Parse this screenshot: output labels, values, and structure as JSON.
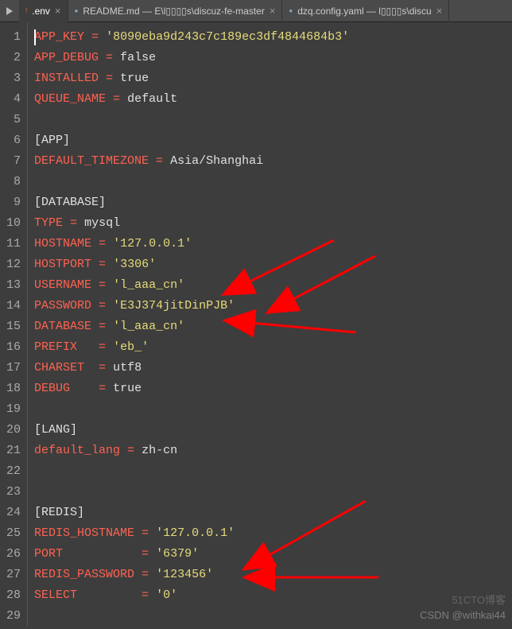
{
  "tabs": [
    {
      "label": ".env",
      "active": true
    },
    {
      "label": "README.md — E\\l▯▯▯▯s\\discuz-fe-master",
      "active": false
    },
    {
      "label": "dzq.config.yaml — l▯▯▯▯s\\discu",
      "active": false
    }
  ],
  "lines": [
    {
      "n": "1",
      "html": "<span class='k'>APP_KEY</span> <span class='eq'>=</span> <span class='s'>'8090eba9d243c7c189ec3df4844684b3'</span>"
    },
    {
      "n": "2",
      "html": "<span class='k'>APP_DEBUG</span> <span class='eq'>=</span> <span class='v'>false</span>"
    },
    {
      "n": "3",
      "html": "<span class='k'>INSTALLED</span> <span class='eq'>=</span> <span class='v'>true</span>"
    },
    {
      "n": "4",
      "html": "<span class='k'>QUEUE_NAME</span> <span class='eq'>=</span> <span class='v'>default</span>"
    },
    {
      "n": "5",
      "html": ""
    },
    {
      "n": "6",
      "html": "<span class='hd'>[APP]</span>"
    },
    {
      "n": "7",
      "html": "<span class='k'>DEFAULT_TIMEZONE</span> <span class='eq'>=</span> <span class='v'>Asia/Shanghai</span>"
    },
    {
      "n": "8",
      "html": ""
    },
    {
      "n": "9",
      "html": "<span class='hd'>[DATABASE]</span>"
    },
    {
      "n": "10",
      "html": "<span class='k'>TYPE</span> <span class='eq'>=</span> <span class='v'>mysql</span>"
    },
    {
      "n": "11",
      "html": "<span class='k'>HOSTNAME</span> <span class='eq'>=</span> <span class='s'>'127.0.0.1'</span>"
    },
    {
      "n": "12",
      "html": "<span class='k'>HOSTPORT</span> <span class='eq'>=</span> <span class='s'>'3306'</span>"
    },
    {
      "n": "13",
      "html": "<span class='k'>USERNAME</span> <span class='eq'>=</span> <span class='s'>'l_aaa_cn'</span>"
    },
    {
      "n": "14",
      "html": "<span class='k'>PASSWORD</span> <span class='eq'>=</span> <span class='s'>'E3J374jitDinPJB'</span>"
    },
    {
      "n": "15",
      "html": "<span class='k'>DATABASE</span> <span class='eq'>=</span> <span class='s'>'l_aaa_cn'</span>"
    },
    {
      "n": "16",
      "html": "<span class='k'>PREFIX</span>   <span class='eq'>=</span> <span class='s'>'eb_'</span>"
    },
    {
      "n": "17",
      "html": "<span class='k'>CHARSET</span>  <span class='eq'>=</span> <span class='v'>utf8</span>"
    },
    {
      "n": "18",
      "html": "<span class='k'>DEBUG</span>    <span class='eq'>=</span> <span class='v'>true</span>"
    },
    {
      "n": "19",
      "html": ""
    },
    {
      "n": "20",
      "html": "<span class='hd'>[LANG]</span>"
    },
    {
      "n": "21",
      "html": "<span class='k'>default_lang</span> <span class='eq'>=</span> <span class='v'>zh-cn</span>"
    },
    {
      "n": "22",
      "html": ""
    },
    {
      "n": "23",
      "html": ""
    },
    {
      "n": "24",
      "html": "<span class='hd'>[REDIS]</span>"
    },
    {
      "n": "25",
      "html": "<span class='k'>REDIS_HOSTNAME</span> <span class='eq'>=</span> <span class='s'>'127.0.0.1'</span>"
    },
    {
      "n": "26",
      "html": "<span class='k'>PORT</span>           <span class='eq'>=</span> <span class='s'>'6379'</span>"
    },
    {
      "n": "27",
      "html": "<span class='k'>REDIS_PASSWORD</span> <span class='eq'>=</span> <span class='s'>'123456'</span>"
    },
    {
      "n": "28",
      "html": "<span class='k'>SELECT</span>         <span class='eq'>=</span> <span class='s'>'0'</span>"
    },
    {
      "n": "29",
      "html": ""
    }
  ],
  "watermarks": {
    "w1": "51CTO博客",
    "w2": "CSDN @withkai44"
  }
}
